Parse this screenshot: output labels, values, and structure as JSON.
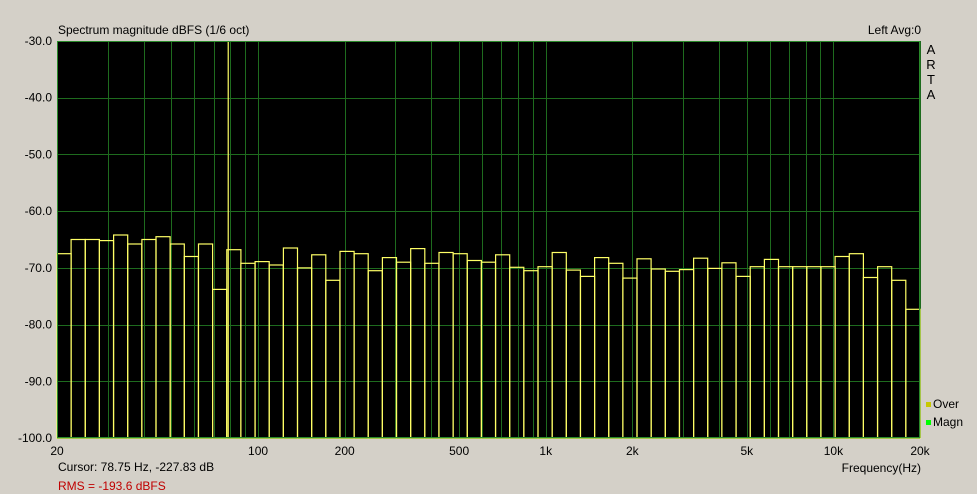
{
  "chart_data": {
    "type": "bar",
    "title": "Spectrum magnitude dBFS (1/6 oct)",
    "status": "Left  Avg:0",
    "brand": [
      "A",
      "R",
      "T",
      "A"
    ],
    "xlabel": "Frequency(Hz)",
    "x_scale": "log",
    "xlim": [
      20,
      20000
    ],
    "ylim": [
      -100,
      -30
    ],
    "grid": true,
    "y_ticks": [
      "-30.0",
      "-40.0",
      "-50.0",
      "-60.0",
      "-70.0",
      "-80.0",
      "-90.0",
      "-100.0"
    ],
    "y_tick_values": [
      -30,
      -40,
      -50,
      -60,
      -70,
      -80,
      -90,
      -100
    ],
    "x_ticks": [
      "20",
      "100",
      "200",
      "500",
      "1k",
      "2k",
      "5k",
      "10k",
      "20k"
    ],
    "x_tick_values": [
      20,
      100,
      200,
      500,
      1000,
      2000,
      5000,
      10000,
      20000
    ],
    "cursor_text": "Cursor:    78.75 Hz, -227.83 dB",
    "cursor_freq": 78.75,
    "rms_text": "RMS = -193.6 dBFS",
    "legend": [
      {
        "name": "Over",
        "color": "#c8c800"
      },
      {
        "name": "Magn",
        "color": "#00ff00"
      }
    ],
    "bar_color": "#ffff66",
    "plot_bg": "#000000",
    "grid_color": "#1e6b1e",
    "values": [
      -67.5,
      -65,
      -65,
      -65.2,
      -64.2,
      -65.8,
      -65,
      -64.5,
      -65.8,
      -68,
      -65.8,
      -73.8,
      -66.8,
      -69.2,
      -68.9,
      -69.5,
      -66.5,
      -70,
      -67.7,
      -72.2,
      -67.1,
      -67.5,
      -70.5,
      -68.2,
      -69,
      -66.6,
      -69.2,
      -67.3,
      -67.5,
      -68.7,
      -69,
      -67.7,
      -69.9,
      -70.5,
      -69.8,
      -67.3,
      -70.4,
      -71.5,
      -68.2,
      -69.2,
      -71.8,
      -68.4,
      -70.2,
      -70.6,
      -70.3,
      -68.3,
      -70.1,
      -69.1,
      -71.5,
      -69.8,
      -68.5,
      -69.8,
      -69.8,
      -69.8,
      -69.8,
      -68,
      -67.5,
      -71.7,
      -69.8,
      -72.2,
      -77.3
    ]
  }
}
